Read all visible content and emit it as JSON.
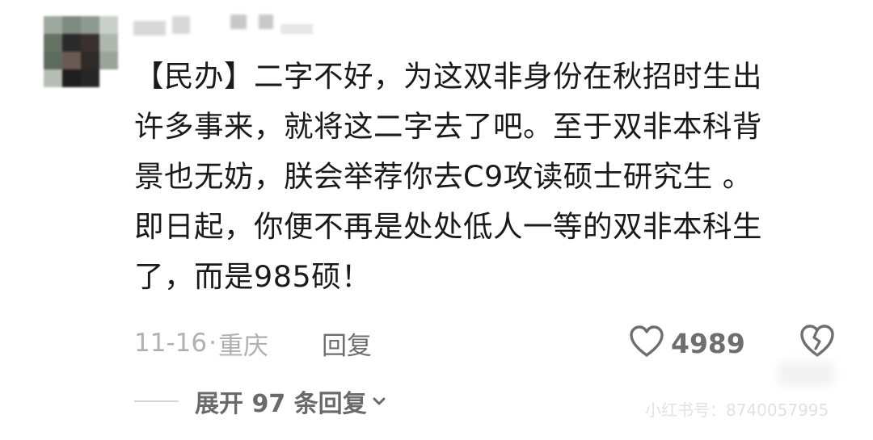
{
  "comment": {
    "lines": [
      "【民办】二字不好，为这双非身份在秋招时生出",
      "许多事来，就将这二字去了吧。至于双非本科背",
      "景也无妨，朕会举荐你去C9攻读硕士研究生 。",
      "即日起，你便不再是处处低人一等的双非本科生",
      "了，而是985硕！"
    ],
    "date": "11-16",
    "separator": "·",
    "location": "重庆",
    "reply_label": "回复",
    "like_count": "4989",
    "expand_label": "展开 97 条回复"
  },
  "watermark": "小红书号：8740057995",
  "icons": {
    "like": "heart-outline-icon",
    "dislike": "broken-heart-icon",
    "expand": "chevron-down-icon"
  },
  "colors": {
    "text": "#1a1a1a",
    "meta": "#b0b0b0",
    "action": "#6e6e6e"
  }
}
